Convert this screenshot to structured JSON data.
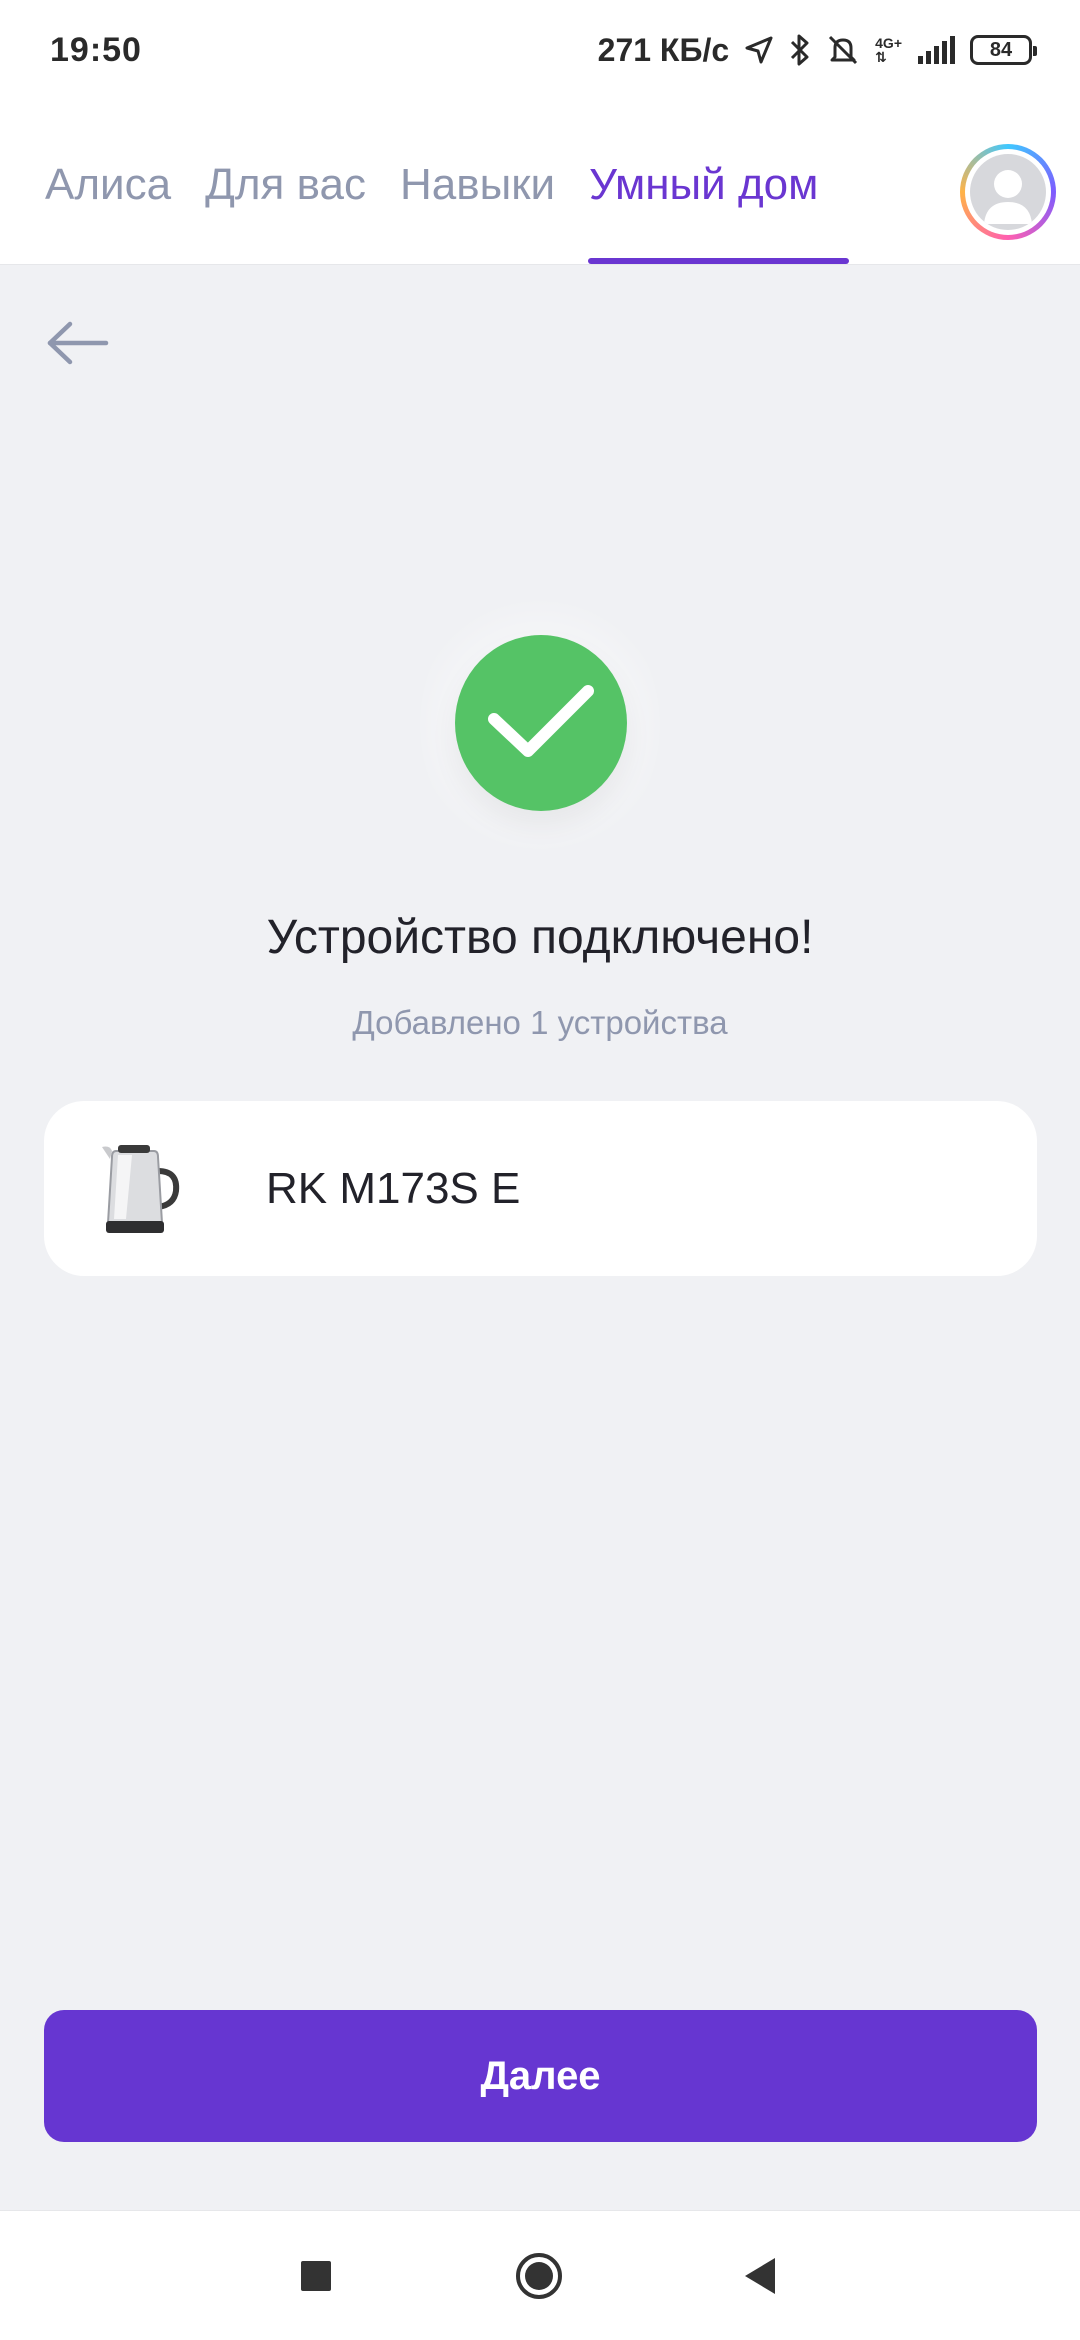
{
  "status_bar": {
    "time": "19:50",
    "speed": "271 КБ/с",
    "net_type_top": "4G+",
    "battery": "84"
  },
  "tabs": [
    {
      "label": "Алиса",
      "active": false
    },
    {
      "label": "Для вас",
      "active": false
    },
    {
      "label": "Навыки",
      "active": false
    },
    {
      "label": "Умный дом",
      "active": true
    }
  ],
  "colors": {
    "accent": "#6a36d1",
    "success": "#55c366",
    "muted": "#8f97ae",
    "background": "#f0f1f4"
  },
  "icons": {
    "back": "arrow-left-icon",
    "success": "checkmark-icon",
    "device": "kettle-icon",
    "avatar": "user-avatar-icon"
  },
  "main": {
    "title": "Устройство подключено!",
    "subtitle": "Добавлено 1 устройства",
    "devices": [
      {
        "name": "RK M173S E"
      }
    ],
    "next_label": "Далее"
  }
}
